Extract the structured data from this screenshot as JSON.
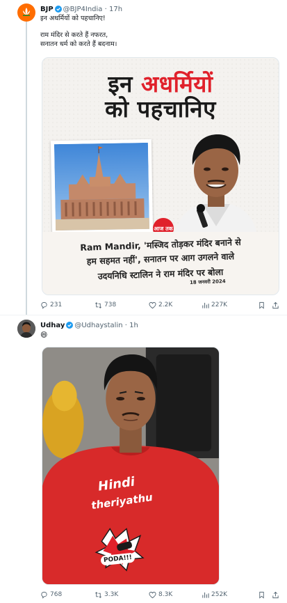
{
  "tweets": [
    {
      "author": {
        "name": "BJP",
        "handle": "@BJP4India",
        "time": "17h",
        "verified": true
      },
      "text_lines": [
        "इन अधर्मियों को पहचानिए!",
        "राम मंदिर से करते हैं नफरत,",
        "सनातन धर्म को करते हैं बदनाम।"
      ],
      "media": {
        "headline_top_black": "इन",
        "headline_top_red": "अधर्मियों",
        "headline_bottom": "को पहचानिए",
        "logo": "आज तक",
        "caption_lines": [
          "Ram Mandir, 'मस्जिद तोड़कर मंदिर बनाने से",
          "हम सहमत नहीं', सनातन पर आग उगलने वाले",
          "उदयनिधि स्टालिन ने राम मंदिर पर बोला"
        ],
        "date": "18 जनवरी 2024"
      },
      "stats": {
        "replies": "231",
        "retweets": "738",
        "likes": "2.2K",
        "views": "227K"
      }
    },
    {
      "author": {
        "name": "Udhay",
        "handle": "@Udhaystalin",
        "time": "1h",
        "verified": true
      },
      "text_lines": [
        "😄"
      ],
      "media": {
        "shirt_line1": "Hindi",
        "shirt_line2": "theriyathu",
        "badge": "PODA!!!"
      },
      "stats": {
        "replies": "768",
        "retweets": "3.3K",
        "likes": "8.3K",
        "views": "252K"
      }
    }
  ],
  "icons": [
    "verified-badge-icon",
    "reply-icon",
    "retweet-icon",
    "like-icon",
    "views-icon",
    "bookmark-icon",
    "share-icon"
  ],
  "colors": {
    "verified": "#1d9bf0",
    "text": "#0f1419",
    "muted": "#536471",
    "accent_red": "#e0212b",
    "bjp_orange": "#ff6d00"
  }
}
